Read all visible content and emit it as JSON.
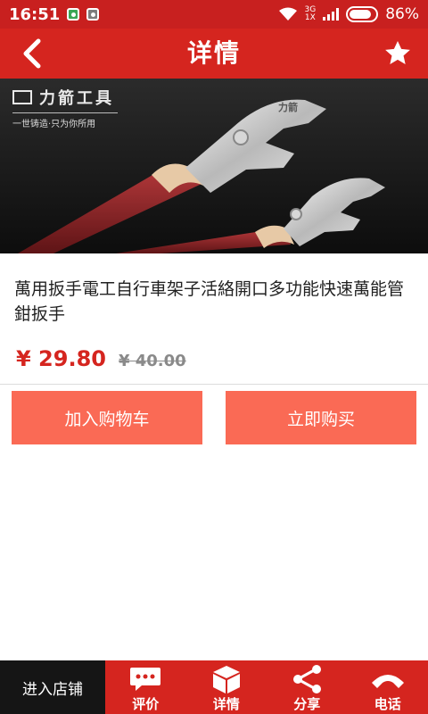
{
  "status_bar": {
    "time": "16:51",
    "network_type": [
      "3G",
      "1X"
    ],
    "battery": "86%"
  },
  "header": {
    "title": "详情",
    "back_icon": "chevron-left-icon",
    "favorite_icon": "star-icon"
  },
  "product_image": {
    "brand_name": "力箭工具",
    "brand_slogan": "一世铸造·只为你所用",
    "tool_label": "力箭"
  },
  "product": {
    "name": "萬用扳手電工自行車架子活絡開口多功能快速萬能管鉗扳手",
    "current_price": "¥ 29.80",
    "original_price": "¥ 40.00"
  },
  "actions": {
    "add_to_cart": "加入购物车",
    "buy_now": "立即购买"
  },
  "bottom_bar": {
    "enter_store": "进入店铺",
    "tabs": [
      {
        "label": "评价",
        "icon": "comment-icon"
      },
      {
        "label": "详情",
        "icon": "box-icon"
      },
      {
        "label": "分享",
        "icon": "share-icon"
      },
      {
        "label": "电话",
        "icon": "phone-icon"
      }
    ]
  },
  "colors": {
    "header_red": "#d5251f",
    "button_coral": "#fa6a55",
    "price_red": "#d5251f"
  }
}
